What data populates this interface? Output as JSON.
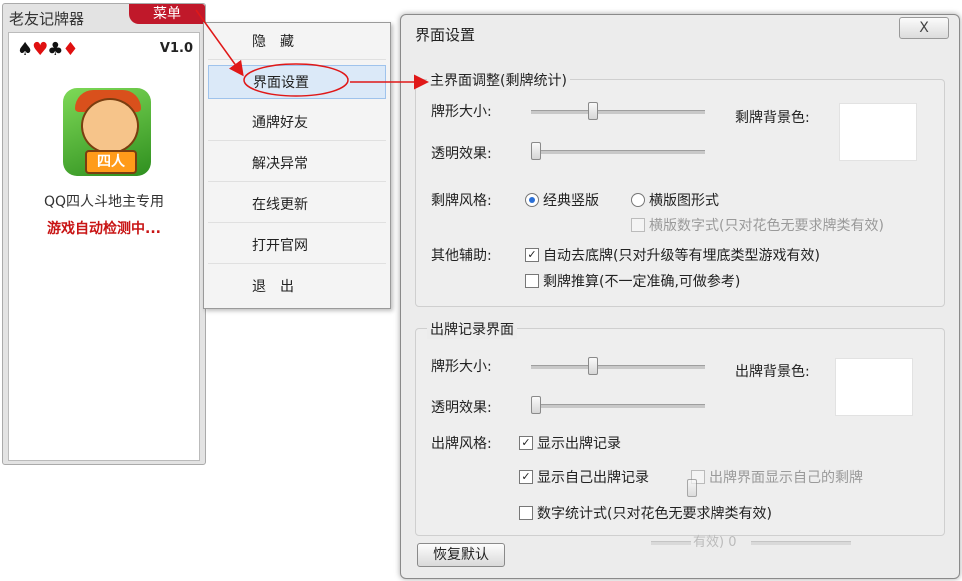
{
  "main_window": {
    "title": "老友记牌器",
    "menu_tab": "菜单",
    "suits": [
      "♠",
      "♥",
      "♣",
      "♦"
    ],
    "version": "V1.0",
    "logo_text": "四人",
    "subtitle": "QQ四人斗地主专用",
    "status": "游戏自动检测中..."
  },
  "popup_menu": {
    "items": [
      {
        "label": "隐　藏"
      },
      {
        "label": "界面设置"
      },
      {
        "label": "通牌好友"
      },
      {
        "label": "解决异常"
      },
      {
        "label": "在线更新"
      },
      {
        "label": "打开官网"
      },
      {
        "label": "退　出"
      }
    ]
  },
  "dialog": {
    "title": "界面设置",
    "close_label": "X",
    "main_group": {
      "label": "主界面调整(剩牌统计)",
      "card_size_label": "牌形大小:",
      "card_size_level": 0.35,
      "bg_color_label": "剩牌背景色:",
      "transparency_label": "透明效果:",
      "transparency_level": 0.0,
      "style_label": "剩牌风格:",
      "radio_classic": "经典竖版",
      "radio_horizontal": "横版图形式",
      "horizontal_digits": "横版数字式(只对花色无要求牌类有效)",
      "assist_label": "其他辅助:",
      "auto_remove_bottom": "自动去底牌(只对升级等有埋底类型游戏有效)",
      "remaining_estimate": "剩牌推算(不一定准确,可做参考)"
    },
    "record_group": {
      "label": "出牌记录界面",
      "card_size_label": "牌形大小:",
      "card_size_level": 0.35,
      "bg_color_label": "出牌背景色:",
      "transparency_label": "透明效果:",
      "transparency_level": 0.0,
      "style_label": "出牌风格:",
      "show_records": "显示出牌记录",
      "show_own_records": "显示自己出牌记录",
      "show_own_remaining": "出牌界面显示自己的剩牌",
      "digit_stats": "数字统计式(只对花色无要求牌类有效)",
      "ghost_text": "有效) 0"
    },
    "reset_label": "恢复默认"
  },
  "colors": {
    "accent_red": "#c0182a",
    "annotation_red": "#e01818",
    "selection_blue": "#dbe9f8"
  }
}
